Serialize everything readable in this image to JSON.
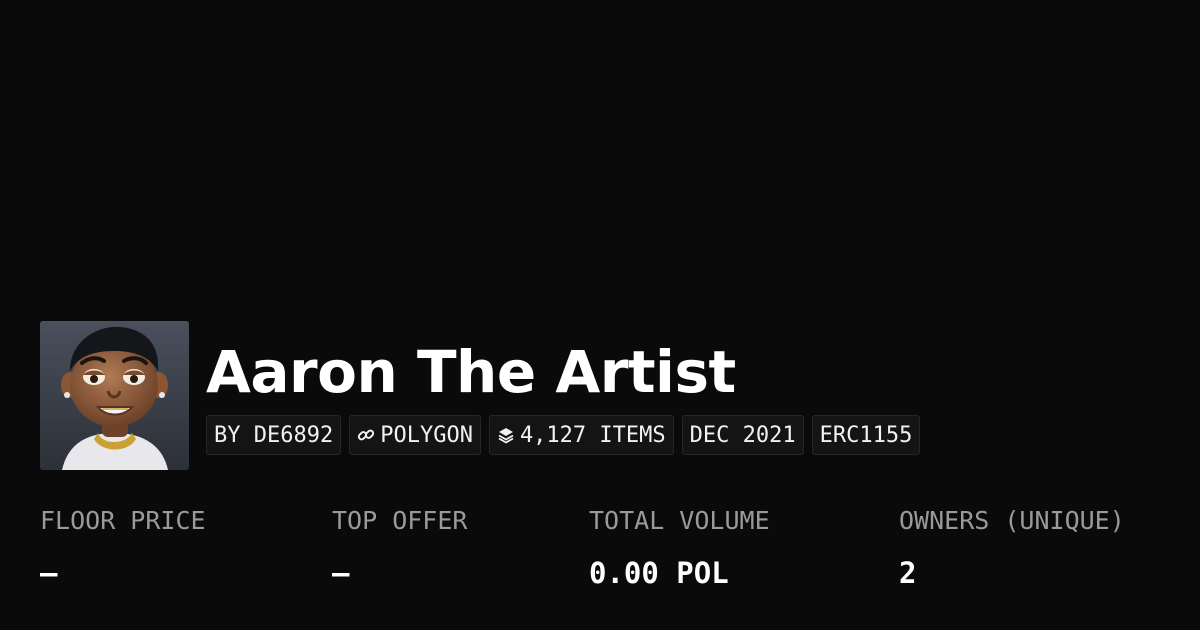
{
  "collection": {
    "name": "Aaron The Artist",
    "avatar_alt": "Aaron The Artist avatar"
  },
  "tags": {
    "creator": "BY DE6892",
    "chain": "POLYGON",
    "items": "4,127 ITEMS",
    "date": "DEC 2021",
    "standard": "ERC1155",
    "chain_icon": "link-icon",
    "items_icon": "layers-icon"
  },
  "stats": {
    "floor_price": {
      "label": "FLOOR PRICE",
      "value": "–"
    },
    "top_offer": {
      "label": "TOP OFFER",
      "value": "–"
    },
    "total_volume": {
      "label": "TOTAL VOLUME",
      "value": "0.00 POL"
    },
    "owners": {
      "label": "OWNERS (UNIQUE)",
      "value": "2"
    }
  },
  "colors": {
    "background": "#0a0a0a",
    "tag_background": "#141414",
    "tag_border": "#262626",
    "label": "#9a9a9a",
    "text": "#ffffff"
  }
}
